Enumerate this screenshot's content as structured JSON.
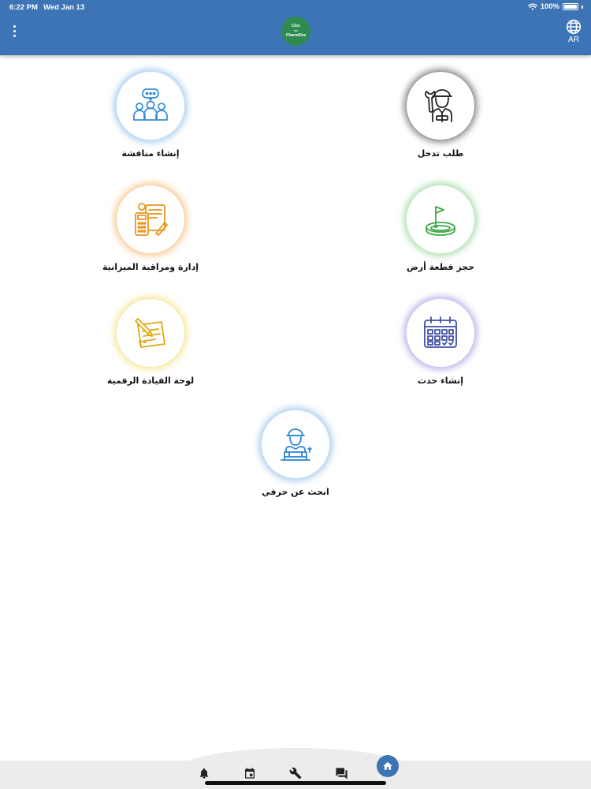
{
  "status_bar": {
    "time": "6:22 PM",
    "date": "Wed Jan 13",
    "battery": "100%"
  },
  "header": {
    "logo_line1": "Clos",
    "logo_line2": "des",
    "logo_line3": "Charmilles",
    "language": "AR"
  },
  "tiles": [
    {
      "label": "إنشاء مناقشة",
      "icon": "discussion-group-icon",
      "color": "#3a8fd6"
    },
    {
      "label": "طلب تدخل",
      "icon": "technician-icon",
      "color": "#222222"
    },
    {
      "label": "إدارة ومراقبة الميزانية",
      "icon": "budget-calculator-icon",
      "color": "#e8961c"
    },
    {
      "label": "حجز قطعة أرض",
      "icon": "golf-flag-icon",
      "color": "#3daa45"
    },
    {
      "label": "لوحة القيادة الرقمية",
      "icon": "notepad-pencil-icon",
      "color": "#e0a912"
    },
    {
      "label": "إنشاء حدث",
      "icon": "calendar-icon",
      "color": "#3f4fa8"
    },
    {
      "label": "ابحث عن حرفي",
      "icon": "craftsman-icon",
      "color": "#2f86d0"
    }
  ],
  "bottom_nav": [
    {
      "icon": "bell-icon"
    },
    {
      "icon": "calendar-event-icon"
    },
    {
      "icon": "wrench-icon"
    },
    {
      "icon": "chat-icon"
    },
    {
      "icon": "home-icon"
    }
  ]
}
